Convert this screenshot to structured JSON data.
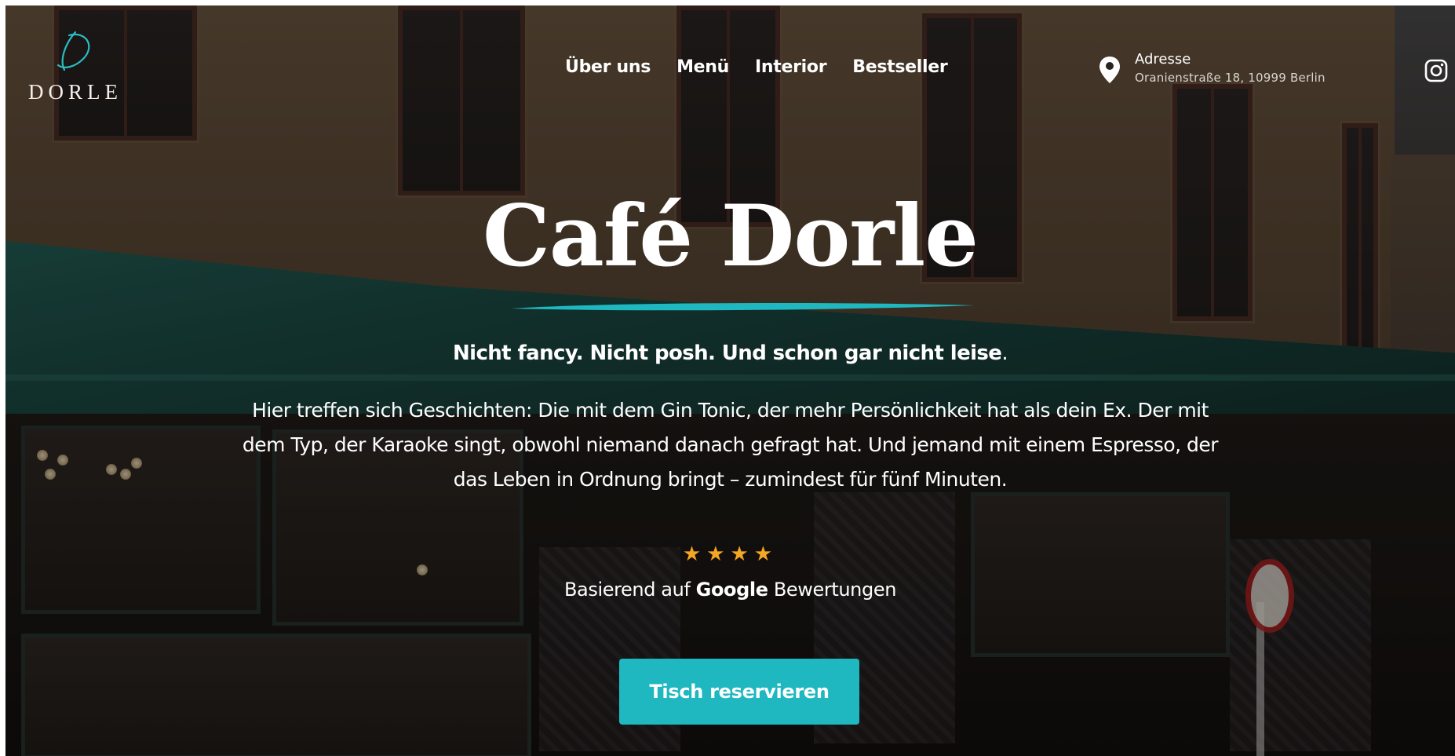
{
  "brand": {
    "logo_text": "DORLE",
    "logo_icon": "script-d-icon"
  },
  "nav": {
    "items": [
      {
        "label": "Über uns"
      },
      {
        "label": "Menü"
      },
      {
        "label": "Interior"
      },
      {
        "label": "Bestseller"
      }
    ]
  },
  "address": {
    "icon": "map-pin-icon",
    "label": "Adresse",
    "street": "Oranienstraße 18, 10999 Berlin"
  },
  "social": {
    "icon": "instagram-icon"
  },
  "hero": {
    "title": "Café Dorle",
    "tagline": "Nicht fancy. Nicht posh. Und schon gar nicht leise",
    "tagline_end": ".",
    "description": "Hier treffen sich Geschichten: Die mit dem Gin Tonic, der mehr Persönlichkeit hat als dein Ex. Der mit dem Typ, der Karaoke singt, obwohl niemand danach gefragt hat. Und jemand mit einem Espresso, der das Leben in Ordnung bringt – zumindest für fünf Minuten.",
    "rating_stars": 4,
    "stars_text": "★★★★",
    "reviews_prefix": "Basierend auf ",
    "reviews_brand": "Google",
    "reviews_suffix": " Bewertungen",
    "cta_label": "Tisch reservieren"
  },
  "colors": {
    "accent": "#1fb7c0",
    "star": "#f5a623",
    "text": "#ffffff"
  }
}
